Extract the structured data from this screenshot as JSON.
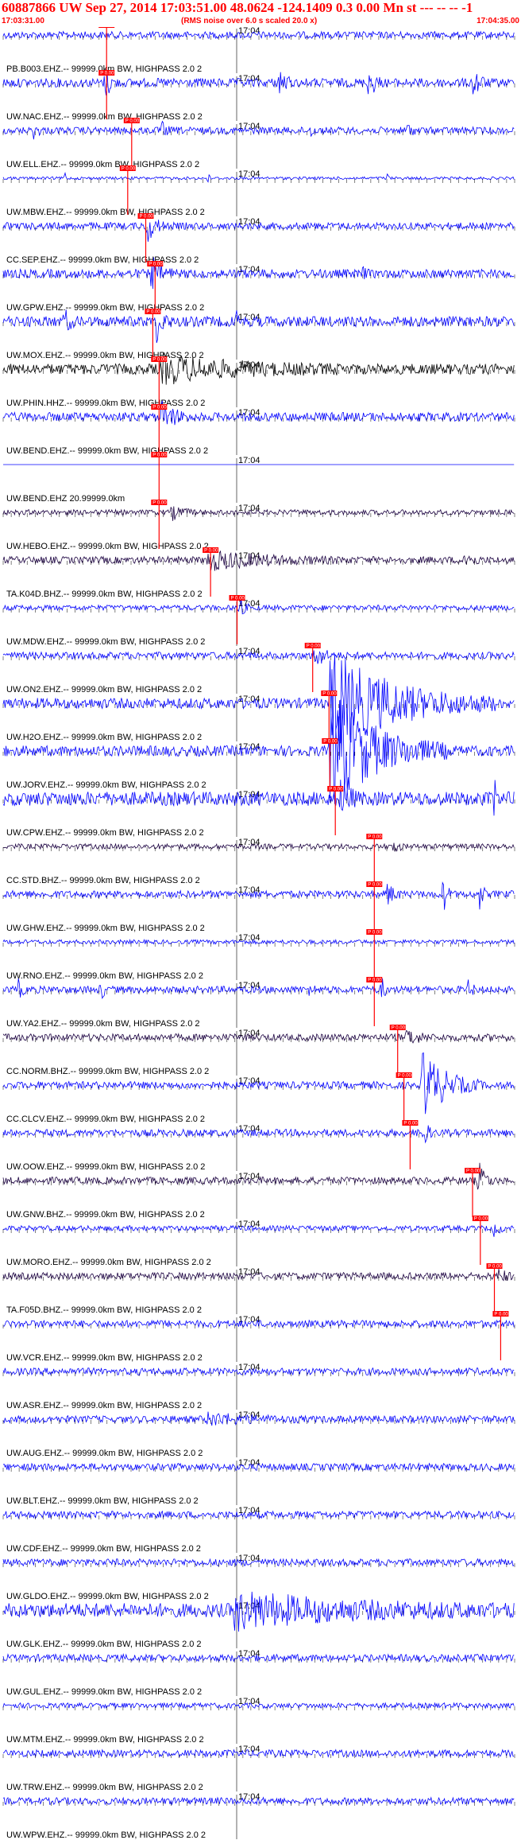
{
  "header": {
    "title": "60887866 UW Sep 27, 2014 17:03:51.00   48.0624 -124.1409  0.3 0.00 Mn st --- -- --  -1",
    "start_time": "17:03:31.00",
    "scale_note": "(RMS noise over 6.0 s scaled 20.0 x)",
    "end_time": "17:04:35.00"
  },
  "minute_label": "17:04",
  "pick_text": "P 0.00",
  "colors": {
    "text_red": "#ff0000",
    "trace_blue": "#0000ff",
    "trace_dark": "#1a0040",
    "trace_black": "#000000",
    "pick_red": "#ff0000",
    "grid": "#000000"
  },
  "traces": [
    {
      "label": "PB.B003.EHZ.-- 99999.0km BW, HIGHPASS  2.0  2",
      "color": "blue",
      "amp": 0.2,
      "pick": 0.2022,
      "ticks_below": true,
      "events": []
    },
    {
      "label": "UW.NAC.EHZ.-- 99999.0km BW, HIGHPASS  2.0  2",
      "color": "blue",
      "amp": 0.25,
      "pick": 0.2022,
      "ticks_below": true,
      "events": [
        [
          0.2,
          5,
          0.9
        ],
        [
          0.54,
          5,
          1
        ],
        [
          0.715,
          5,
          1
        ],
        [
          0.92,
          5,
          1
        ]
      ]
    },
    {
      "label": "UW.ELL.EHZ.-- 99999.0km BW, HIGHPASS  2.0  2",
      "color": "blue",
      "amp": 0.2,
      "pick": 0.2512,
      "ticks_below": true,
      "events": [
        [
          0.06,
          4,
          0.4
        ],
        [
          0.31,
          4,
          0.4
        ],
        [
          0.6,
          3,
          0.3
        ],
        [
          0.79,
          4,
          0.4
        ]
      ]
    },
    {
      "label": "UW.MBW.EHZ.-- 99999.0km BW, HIGHPASS  2.0  2",
      "color": "blue",
      "amp": 0.08,
      "pick": 0.2435,
      "ticks_below": true,
      "events": [
        [
          0.12,
          1,
          0.5
        ],
        [
          0.4,
          1,
          0.3
        ],
        [
          0.75,
          1,
          0.3
        ]
      ]
    },
    {
      "label": "CC.SEP.EHZ.-- 99999.0km BW, HIGHPASS  2.0  2",
      "color": "blue",
      "amp": 0.2,
      "pick": 0.2788,
      "ticks_below": true,
      "events": [
        [
          0.28,
          8,
          1
        ]
      ]
    },
    {
      "label": "UW.GPW.EHZ.-- 99999.0km BW, HIGHPASS  2.0  2",
      "color": "blue",
      "amp": 0.25,
      "pick": 0.2971,
      "ticks_below": true,
      "events": [
        [
          0.29,
          10,
          0.9
        ],
        [
          0.7,
          3,
          0.4
        ]
      ]
    },
    {
      "label": "UW.MOX.EHZ.-- 99999.0km BW, HIGHPASS  2.0  2",
      "color": "blue",
      "amp": 0.3,
      "pick": 0.2925,
      "ticks_below": true,
      "events": [
        [
          0.12,
          4,
          0.7
        ],
        [
          0.3,
          6,
          1
        ],
        [
          0.45,
          4,
          0.8
        ]
      ]
    },
    {
      "label": "UW.PHIN.HHZ.-- 99999.0km BW, HIGHPASS  2.0  2",
      "color": "black",
      "amp": 0.3,
      "pick": 0.3048,
      "ticks_below": true,
      "events": [
        [
          0.31,
          80,
          0.7
        ]
      ]
    },
    {
      "label": "UW.BEND.EHZ.-- 99999.0km BW, HIGHPASS  2.0  2",
      "color": "blue",
      "amp": 0.25,
      "pick": 0.3048,
      "ticks_below": true,
      "events": [
        [
          0.31,
          12,
          0.9
        ]
      ]
    },
    {
      "label": "UW.BEND.EHZ 20.99999.0km",
      "color": "blue",
      "amp": 0.0,
      "pick": 0.3048,
      "ticks_below": false,
      "events": []
    },
    {
      "label": "UW.HEBO.EHZ.-- 99999.0km BW, HIGHPASS  2.0  2",
      "color": "dark",
      "amp": 0.15,
      "pick": 0.3048,
      "ticks_below": true,
      "events": [
        [
          0.33,
          10,
          0.4
        ]
      ]
    },
    {
      "label": "TA.K04D.BHZ.-- 99999.0km BW, HIGHPASS  2.0  2",
      "color": "dark",
      "amp": 0.2,
      "pick": 0.4054,
      "ticks_below": true,
      "events": [
        [
          0.4,
          60,
          0.5
        ],
        [
          0.9,
          8,
          0.5
        ]
      ]
    },
    {
      "label": "UW.MDW.EHZ.-- 99999.0km BW, HIGHPASS  2.0  2",
      "color": "blue",
      "amp": 0.15,
      "pick": 0.4573,
      "ticks_below": true,
      "events": [
        [
          0.46,
          5,
          0.6
        ]
      ]
    },
    {
      "label": "UW.ON2.EHZ.-- 99999.0km BW, HIGHPASS  2.0  2",
      "color": "blue",
      "amp": 0.2,
      "pick": 0.6052,
      "ticks_below": true,
      "events": [
        [
          0.61,
          6,
          1
        ]
      ]
    },
    {
      "label": "UW.H2O.EHZ.-- 99999.0km BW, HIGHPASS  2.0  2",
      "color": "blue",
      "amp": 0.3,
      "pick": 0.6371,
      "ticks_below": true,
      "events": [
        [
          0.64,
          70,
          3
        ]
      ]
    },
    {
      "label": "UW.JORV.EHZ.-- 99999.0km BW, HIGHPASS  2.0  2",
      "color": "blue",
      "amp": 0.3,
      "pick": 0.6386,
      "ticks_below": true,
      "events": [
        [
          0.64,
          50,
          3.5
        ]
      ]
    },
    {
      "label": "UW.CPW.EHZ.-- 99999.0km BW, HIGHPASS  2.0  2",
      "color": "blue",
      "amp": 0.4,
      "pick": 0.6494,
      "ticks_below": true,
      "events": [
        [
          0.66,
          8,
          1
        ],
        [
          0.96,
          2,
          1
        ]
      ]
    },
    {
      "label": "CC.STD.BHZ.-- 99999.0km BW, HIGHPASS  2.0  2",
      "color": "dark",
      "amp": 0.15,
      "pick": 0.7256,
      "ticks_below": true,
      "events": [
        [
          0.76,
          5,
          0.5
        ]
      ]
    },
    {
      "label": "UW.GHW.EHZ.-- 99999.0km BW, HIGHPASS  2.0  2",
      "color": "blue",
      "amp": 0.2,
      "pick": 0.7256,
      "ticks_below": true,
      "events": [
        [
          0.75,
          6,
          0.7
        ],
        [
          0.86,
          4,
          1
        ],
        [
          0.93,
          3,
          1
        ]
      ]
    },
    {
      "label": "UW.RNO.EHZ.-- 99999.0km BW, HIGHPASS  2.0  2",
      "color": "blue",
      "amp": 0.12,
      "pick": 0.7256,
      "ticks_below": true,
      "events": []
    },
    {
      "label": "UW.YA2.EHZ.-- 99999.0km BW, HIGHPASS  2.0  2",
      "color": "blue",
      "amp": 0.2,
      "pick": 0.7256,
      "ticks_below": true,
      "events": [
        [
          0.03,
          3,
          0.5
        ],
        [
          0.19,
          3,
          0.6
        ],
        [
          0.6,
          3,
          0.4
        ],
        [
          0.74,
          3,
          0.6
        ],
        [
          0.91,
          3,
          0.5
        ]
      ]
    },
    {
      "label": "CC.NORM.BHZ.-- 99999.0km BW, HIGHPASS  2.0  2",
      "color": "dark",
      "amp": 0.2,
      "pick": 0.7713,
      "ticks_below": true,
      "events": [
        [
          0.79,
          10,
          0.5
        ]
      ]
    },
    {
      "label": "CC.CLCV.EHZ.-- 99999.0km BW, HIGHPASS  2.0  2",
      "color": "blue",
      "amp": 0.2,
      "pick": 0.7835,
      "ticks_below": true,
      "events": [
        [
          0.82,
          25,
          2
        ]
      ]
    },
    {
      "label": "UW.OOW.EHZ.-- 99999.0km BW, HIGHPASS  2.0  2",
      "color": "blue",
      "amp": 0.2,
      "pick": 0.7957,
      "ticks_below": true,
      "events": [
        [
          0.82,
          4,
          1
        ]
      ]
    },
    {
      "label": "UW.GNW.BHZ.-- 99999.0km BW, HIGHPASS  2.0  2",
      "color": "dark",
      "amp": 0.2,
      "pick": 0.9177,
      "ticks_below": true,
      "events": [
        [
          0.93,
          6,
          1
        ]
      ]
    },
    {
      "label": "UW.MORO.EHZ.-- 99999.0km BW, HIGHPASS  2.0  2",
      "color": "blue",
      "amp": 0.15,
      "pick": 0.9329,
      "ticks_below": true,
      "events": [
        [
          0.96,
          5,
          0.4
        ]
      ]
    },
    {
      "label": "TA.F05D.BHZ.-- 99999.0km BW, HIGHPASS  2.0  2",
      "color": "dark",
      "amp": 0.2,
      "pick": 0.9604,
      "ticks_below": true,
      "events": [
        [
          0.97,
          5,
          0.5
        ]
      ]
    },
    {
      "label": "UW.VCR.EHZ.-- 99999.0km BW, HIGHPASS  2.0  2",
      "color": "blue",
      "amp": 0.2,
      "pick": 0.9726,
      "ticks_below": true,
      "events": []
    },
    {
      "label": "UW.ASR.EHZ.-- 99999.0km BW, HIGHPASS  2.0  2",
      "color": "blue",
      "amp": 0.2,
      "pick": null,
      "ticks_below": true,
      "events": []
    },
    {
      "label": "UW.AUG.EHZ.-- 99999.0km BW, HIGHPASS  2.0  2",
      "color": "blue",
      "amp": 0.2,
      "pick": null,
      "ticks_below": true,
      "events": [
        [
          0.4,
          40,
          0.3
        ]
      ]
    },
    {
      "label": "UW.BLT.EHZ.-- 99999.0km BW, HIGHPASS  2.0  2",
      "color": "blue",
      "amp": 0.2,
      "pick": null,
      "ticks_below": true,
      "events": []
    },
    {
      "label": "UW.CDF.EHZ.-- 99999.0km BW, HIGHPASS  2.0  2",
      "color": "blue",
      "amp": 0.2,
      "pick": null,
      "ticks_below": true,
      "events": []
    },
    {
      "label": "UW.GLDO.EHZ.-- 99999.0km BW, HIGHPASS  2.0  2",
      "color": "blue",
      "amp": 0.2,
      "pick": null,
      "ticks_below": true,
      "events": []
    },
    {
      "label": "UW.GLK.EHZ.-- 99999.0km BW, HIGHPASS  2.0  2",
      "color": "blue",
      "amp": 0.4,
      "pick": null,
      "ticks_below": true,
      "events": [
        [
          0.45,
          120,
          0.9
        ]
      ]
    },
    {
      "label": "UW.GUL.EHZ.-- 99999.0km BW, HIGHPASS  2.0  2",
      "color": "blue",
      "amp": 0.2,
      "pick": null,
      "ticks_below": true,
      "events": []
    },
    {
      "label": "UW.MTM.EHZ.-- 99999.0km BW, HIGHPASS  2.0  2",
      "color": "blue",
      "amp": 0.15,
      "pick": null,
      "ticks_below": true,
      "events": []
    },
    {
      "label": "UW.TRW.EHZ.-- 99999.0km BW, HIGHPASS  2.0  2",
      "color": "blue",
      "amp": 0.2,
      "pick": null,
      "ticks_below": true,
      "events": []
    },
    {
      "label": "UW.WPW.EHZ.-- 99999.0km BW, HIGHPASS  2.0  2",
      "color": "blue",
      "amp": 0.2,
      "pick": null,
      "ticks_below": true,
      "events": []
    }
  ]
}
